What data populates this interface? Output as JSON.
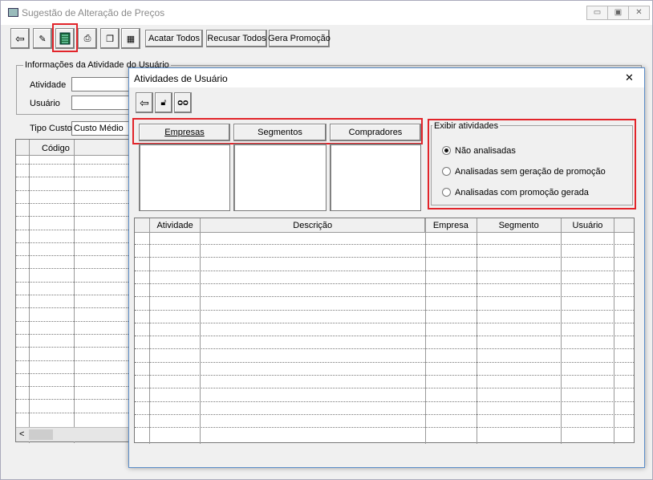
{
  "window": {
    "title": "Sugestão de Alteração de Preços",
    "min_glyph": "▭",
    "max_glyph": "▣",
    "close_glyph": "✕"
  },
  "toolbar": {
    "icons": [
      "exit-icon",
      "pencil-icon",
      "spreadsheet-icon",
      "printer-icon",
      "copy-icon",
      "calendar-icon"
    ],
    "buttons": [
      "Acatar Todos",
      "Recusar Todos",
      "Gera Promoção"
    ]
  },
  "user_info": {
    "group_label": "Informações da Atividade do Usuário",
    "atividade_label": "Atividade",
    "usuario_label": "Usuário"
  },
  "tipo_custo": {
    "label": "Tipo Custo",
    "value": "Custo Médio"
  },
  "main_table": {
    "header": "Código",
    "scroll_left": "<"
  },
  "dialog": {
    "title": "Atividades de Usuário",
    "close": "✕",
    "toolbar_icons": [
      "exit-icon",
      "unlock-icon",
      "binoculars-icon"
    ],
    "filter_buttons": [
      "Empresas",
      "Segmentos",
      "Compradores"
    ],
    "exibir": {
      "label": "Exibir atividades",
      "options": [
        "Não analisadas",
        "Analisadas sem geração de promoção",
        "Analisadas com promoção gerada"
      ],
      "selected": 0
    },
    "table": {
      "headers": [
        "Atividade",
        "Descrição",
        "Empresa",
        "Segmento",
        "Usuário"
      ]
    }
  },
  "colors": {
    "highlight": "#e2242a",
    "dialog_border": "#5a8cc8"
  }
}
